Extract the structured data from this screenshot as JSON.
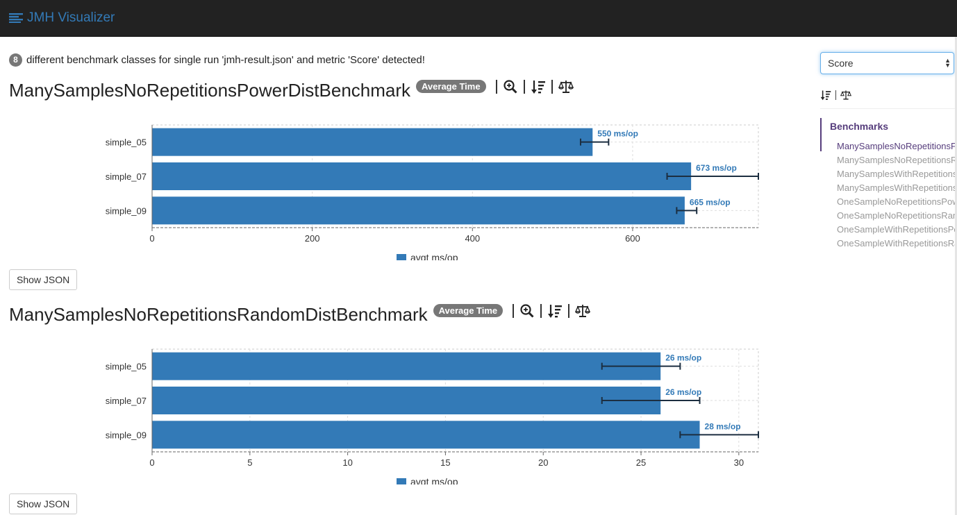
{
  "app": {
    "title": "JMH Visualizer"
  },
  "intro": {
    "count": "8",
    "text": "different benchmark classes for single run 'jmh-result.json' and metric 'Score' detected!"
  },
  "sidebar": {
    "metric_select": "Score",
    "nav_title": "Benchmarks",
    "items": [
      "ManySamplesNoRepetitionsPowerDistBenchmark",
      "ManySamplesNoRepetitionsRandomDistBenchmark",
      "ManySamplesWithRepetitionsPowerDistBenchmark",
      "ManySamplesWithRepetitionsRandomDistBenchmark",
      "OneSampleNoRepetitionsPowerDistBenchmark",
      "OneSampleNoRepetitionsRandomDistBenchmark",
      "OneSampleWithRepetitionsPowerDistBenchmark",
      "OneSampleWithRepetitionsRandomDistBenchmark"
    ]
  },
  "benchmarks": [
    {
      "title": "ManySamplesNoRepetitionsPowerDistBenchmark",
      "mode": "Average Time",
      "show_json": "Show JSON"
    },
    {
      "title": "ManySamplesNoRepetitionsRandomDistBenchmark",
      "mode": "Average Time",
      "show_json": "Show JSON"
    }
  ],
  "chart_data": [
    {
      "type": "bar",
      "orientation": "horizontal",
      "categories": [
        "simple_05",
        "simple_07",
        "simple_09"
      ],
      "series": [
        {
          "name": "avgt ms/op",
          "values": [
            550,
            673,
            665
          ]
        }
      ],
      "errors": [
        [
          535,
          570
        ],
        [
          643,
          760
        ],
        [
          655,
          680
        ]
      ],
      "data_labels": [
        "550 ms/op",
        "673 ms/op",
        "665 ms/op"
      ],
      "xlim": [
        0,
        757
      ],
      "xticks": [
        0,
        200,
        400,
        600
      ],
      "grid": true,
      "legend": "bottom",
      "color": "#337ab7"
    },
    {
      "type": "bar",
      "orientation": "horizontal",
      "categories": [
        "simple_05",
        "simple_07",
        "simple_09"
      ],
      "series": [
        {
          "name": "avgt ms/op",
          "values": [
            26,
            26,
            28
          ]
        }
      ],
      "errors": [
        [
          23,
          27
        ],
        [
          23,
          28
        ],
        [
          27,
          31
        ]
      ],
      "data_labels": [
        "26 ms/op",
        "26 ms/op",
        "28 ms/op"
      ],
      "xlim": [
        0,
        31
      ],
      "xticks": [
        0,
        5,
        10,
        15,
        20,
        25,
        30
      ],
      "grid": true,
      "legend": "bottom",
      "color": "#337ab7"
    }
  ]
}
